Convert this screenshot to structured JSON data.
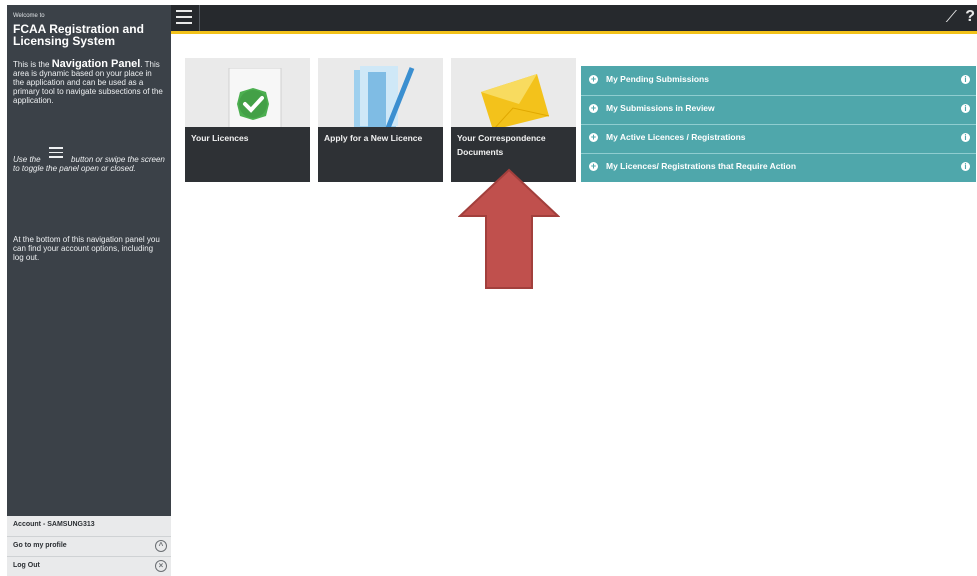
{
  "sidebar": {
    "welcome": "Welcome to",
    "title": "FCAA Registration and Licensing System",
    "intro_prefix": "This is the",
    "intro_bold": "Navigation Panel",
    "intro_rest": ". This area is dynamic based on your place in the application and can be used as a primary tool to navigate subsections of the application.",
    "toggle_before": "Use the",
    "toggle_after": "button or swipe the screen to toggle the panel open or closed.",
    "bottom_note": "At the bottom of this navigation panel you can find your account options, including log out.",
    "account_label": "Account - SAMSUNG313",
    "profile_label": "Go to my profile",
    "logout_label": "Log Out"
  },
  "tiles": [
    {
      "label": "Your Licences",
      "icon": "licence-check-icon"
    },
    {
      "label": "Apply for a New Licence",
      "icon": "folder-pen-icon"
    },
    {
      "label": "Your Correspondence Documents",
      "icon": "envelope-icon"
    }
  ],
  "panel": {
    "rows": [
      {
        "label": "My Pending Submissions"
      },
      {
        "label": "My Submissions in Review"
      },
      {
        "label": "My Active Licences / Registrations"
      },
      {
        "label": "My Licences/ Registrations that Require Action"
      }
    ]
  },
  "colors": {
    "sidebar": "#3b4148",
    "topbar": "#26292d",
    "accent": "#f2c21a",
    "panel": "#4fa7ab",
    "tile_label": "#2e3135",
    "arrow": "#c0504d"
  }
}
